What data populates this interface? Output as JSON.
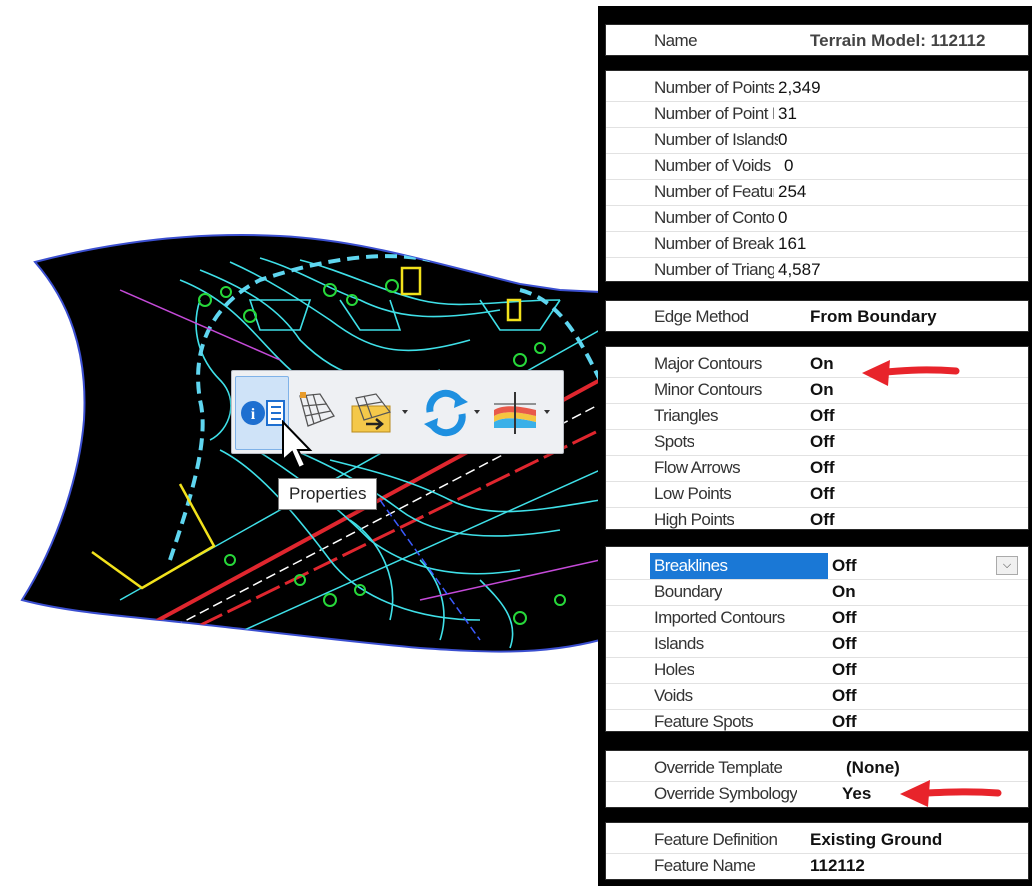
{
  "toolbar": {
    "buttons": [
      {
        "icon": "properties-info-icon"
      },
      {
        "icon": "terrain-mesh-icon"
      },
      {
        "icon": "terrain-export-icon"
      },
      {
        "icon": "refresh-icon"
      },
      {
        "icon": "profile-section-icon"
      }
    ],
    "tooltip": "Properties"
  },
  "properties": {
    "name_group": [
      {
        "label": "Name",
        "value": "Terrain Model: 112112"
      }
    ],
    "stats_group": [
      {
        "label": "Number of Points",
        "value": "2,349"
      },
      {
        "label": "Number of Point F",
        "value": "31"
      },
      {
        "label": "Number of Islands",
        "value": "0"
      },
      {
        "label": "Number of Voids",
        "value": "0"
      },
      {
        "label": "Number of Feature",
        "value": "254"
      },
      {
        "label": "Number of Contou",
        "value": "0"
      },
      {
        "label": "Number of Breakli",
        "value": "161"
      },
      {
        "label": "Number of Triangl",
        "value": "4,587"
      }
    ],
    "edge_group": [
      {
        "label": "Edge Method",
        "value": "From Boundary"
      }
    ],
    "display_group": [
      {
        "label": "Major Contours",
        "value": "On"
      },
      {
        "label": "Minor Contours",
        "value": "On"
      },
      {
        "label": "Triangles",
        "value": "Off"
      },
      {
        "label": "Spots",
        "value": "Off"
      },
      {
        "label": "Flow Arrows",
        "value": "Off"
      },
      {
        "label": "Low Points",
        "value": "Off"
      },
      {
        "label": "High Points",
        "value": "Off"
      }
    ],
    "features_group": [
      {
        "label": "Breaklines",
        "value": "Off"
      },
      {
        "label": "Boundary",
        "value": "On"
      },
      {
        "label": "Imported Contours",
        "value": "Off"
      },
      {
        "label": "Islands",
        "value": "Off"
      },
      {
        "label": "Holes",
        "value": "Off"
      },
      {
        "label": "Voids",
        "value": "Off"
      },
      {
        "label": "Feature Spots",
        "value": "Off"
      }
    ],
    "override_group": [
      {
        "label": "Override Template",
        "value": "(None)"
      },
      {
        "label": "Override Symbology",
        "value": "Yes"
      }
    ],
    "feature_group": [
      {
        "label": "Feature Definition",
        "value": "Existing Ground"
      },
      {
        "label": "Feature Name",
        "value": "112112"
      }
    ]
  },
  "colors": {
    "canvas": "#000000",
    "contour_cyan": "#3fe0e8",
    "boundary_dash": "#5fd6f0",
    "highlight_yellow": "#f2e21c",
    "highlight_green": "#27d83a",
    "road_red": "#e0262e",
    "annotation_arrow": "#e8242b",
    "selection_blue": "#1a78d6"
  }
}
